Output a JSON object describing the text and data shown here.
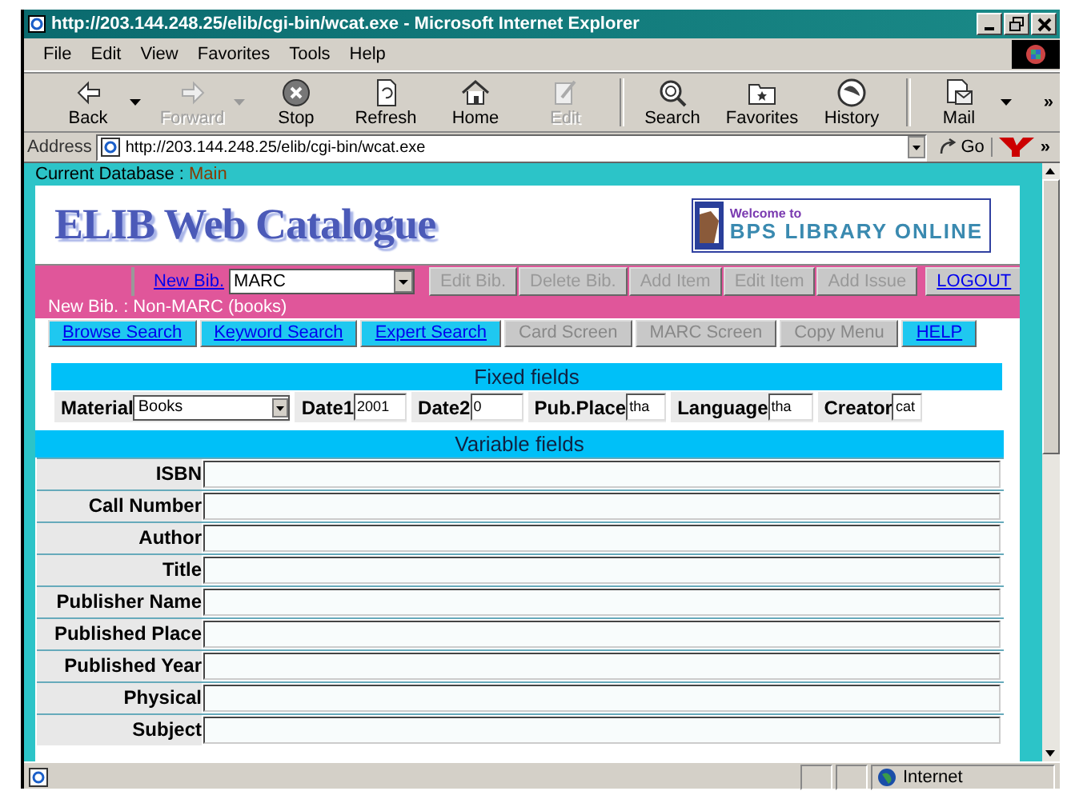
{
  "window": {
    "title": "http://203.144.248.25/elib/cgi-bin/wcat.exe - Microsoft Internet Explorer"
  },
  "menu": [
    "File",
    "Edit",
    "View",
    "Favorites",
    "Tools",
    "Help"
  ],
  "toolbar": [
    {
      "label": "Back",
      "disabled": false,
      "dropdown": true
    },
    {
      "label": "Forward",
      "disabled": true,
      "dropdown": true
    },
    {
      "label": "Stop",
      "disabled": false,
      "dropdown": false
    },
    {
      "label": "Refresh",
      "disabled": false,
      "dropdown": false
    },
    {
      "label": "Home",
      "disabled": false,
      "dropdown": false
    },
    {
      "label": "Edit",
      "disabled": true,
      "dropdown": false
    },
    {
      "label": "Search",
      "disabled": false,
      "dropdown": false
    },
    {
      "label": "Favorites",
      "disabled": false,
      "dropdown": false
    },
    {
      "label": "History",
      "disabled": false,
      "dropdown": false
    },
    {
      "label": "Mail",
      "disabled": false,
      "dropdown": true
    }
  ],
  "toolbar_more": "»",
  "address_bar": {
    "label": "Address",
    "value": "http://203.144.248.25/elib/cgi-bin/wcat.exe",
    "go": "Go",
    "more": "»"
  },
  "page": {
    "current_database": {
      "label": "Current Database :",
      "value": "Main"
    },
    "heading": "ELIB Web Catalogue",
    "banner": {
      "line_1": "Welcome to",
      "line_2": "BPS LIBRARY ONLINE"
    },
    "new_bib": {
      "link": "New Bib.",
      "format": "MARC"
    },
    "actions": [
      {
        "label": "Edit Bib.",
        "disabled": true
      },
      {
        "label": "Delete Bib.",
        "disabled": true
      },
      {
        "label": "Add Item",
        "disabled": true
      },
      {
        "label": "Edit Item",
        "disabled": true
      },
      {
        "label": "Add Issue",
        "disabled": true
      },
      {
        "label": "LOGOUT",
        "disabled": false
      }
    ],
    "notice": "New Bib. : Non-MARC (books)",
    "nav": [
      {
        "label": "Browse Search",
        "disabled": false
      },
      {
        "label": "Keyword Search",
        "disabled": false
      },
      {
        "label": "Expert Search",
        "disabled": false
      },
      {
        "label": "Card Screen",
        "disabled": true
      },
      {
        "label": "MARC Screen",
        "disabled": true
      },
      {
        "label": "Copy Menu",
        "disabled": true
      },
      {
        "label": "HELP",
        "disabled": false
      }
    ],
    "fixed_fields": {
      "title": "Fixed fields",
      "fields": [
        {
          "label": "Material",
          "value": "Books",
          "kind": "select"
        },
        {
          "label": "Date1",
          "value": "2001",
          "kind": "text"
        },
        {
          "label": "Date2",
          "value": "0",
          "kind": "text"
        },
        {
          "label": "Pub.Place",
          "value": "tha",
          "kind": "text"
        },
        {
          "label": "Language",
          "value": "tha",
          "kind": "text"
        },
        {
          "label": "Creator",
          "value": "cat",
          "kind": "text"
        }
      ]
    },
    "variable_fields": {
      "title": "Variable fields",
      "rows": [
        {
          "label": "ISBN"
        },
        {
          "label": "Call Number"
        },
        {
          "label": "Author"
        },
        {
          "label": "Title"
        },
        {
          "label": "Publisher Name"
        },
        {
          "label": "Published Place"
        },
        {
          "label": "Published Year"
        },
        {
          "label": "Physical"
        },
        {
          "label": "Subject"
        }
      ]
    }
  },
  "status_bar": {
    "zone": "Internet"
  }
}
